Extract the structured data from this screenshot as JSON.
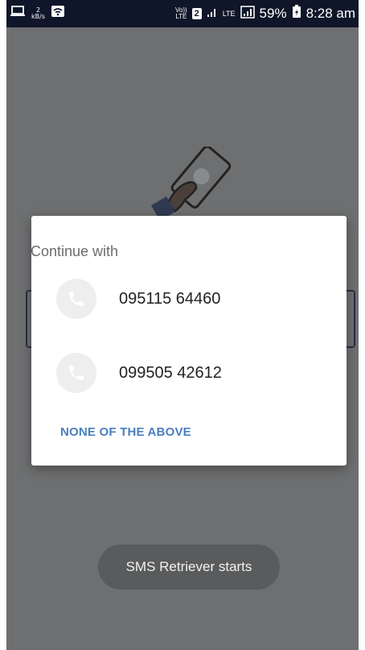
{
  "status_bar": {
    "data_speed_value": "2",
    "data_speed_unit": "kB/s",
    "volte_label_top": "Vo))",
    "volte_label_bottom": "LTE",
    "sim_slot": "2",
    "lte_label": "LTE",
    "battery_percent": "59%",
    "time": "8:28 am"
  },
  "dialog": {
    "title": "Continue with",
    "accounts": [
      {
        "phone": "095115 64460",
        "icon": "phone-icon"
      },
      {
        "phone": "099505 42612",
        "icon": "phone-icon"
      }
    ],
    "none_button_label": "NONE OF THE ABOVE"
  },
  "toast": {
    "message": "SMS Retriever starts"
  },
  "colors": {
    "status_bar_bg": "#0f1629",
    "scrim_bg": "#6e6f70",
    "dialog_bg": "#ffffff",
    "accent_link": "#4a7fc0",
    "toast_bg": "#5a5b5c"
  }
}
